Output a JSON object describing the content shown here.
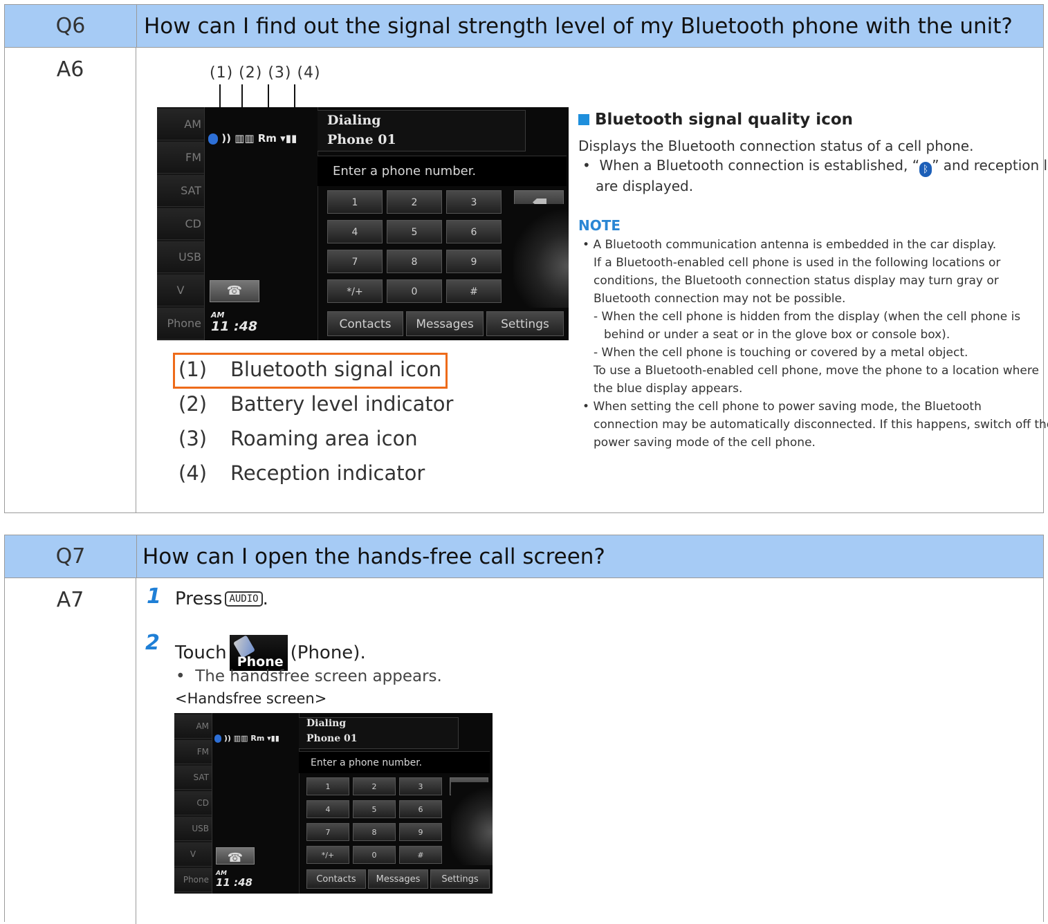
{
  "q6": {
    "number": "Q6",
    "question": "How can I find out the signal strength level of my Bluetooth phone with the unit?",
    "answer_number": "A6",
    "callout_numbers": "(1) (2)  (3)  (4)",
    "legend": [
      {
        "n": "(1)",
        "label": "Bluetooth signal icon",
        "highlighted": true
      },
      {
        "n": "(2)",
        "label": "Battery level indicator"
      },
      {
        "n": "(3)",
        "label": "Roaming area icon"
      },
      {
        "n": "(4)",
        "label": "Reception indicator"
      }
    ],
    "right": {
      "heading": "Bluetooth signal quality icon",
      "desc": "Displays the Bluetooth connection status of a cell phone.",
      "bullet1_a": "When a Bluetooth connection is established, “",
      "bullet1_b": "” and reception level",
      "bullet1_c": "are displayed.",
      "note_title": "NOTE",
      "note_lines": [
        "A Bluetooth communication antenna is embedded in the car display.",
        "If a Bluetooth-enabled cell phone is used in the following locations or",
        "conditions, the Bluetooth connection status display may turn gray or",
        "Bluetooth connection may not be possible.",
        "When the cell phone is hidden from the display (when the cell phone is",
        "behind or under a seat or in the glove box or console box).",
        "When the cell phone is touching or covered by a metal object.",
        "To use a Bluetooth-enabled cell phone, move the phone to a location where",
        "the blue display appears.",
        "When setting the cell phone to power saving mode, the Bluetooth",
        "connection may be automatically disconnected. If this happens, switch off the",
        "power saving mode of the cell phone."
      ]
    }
  },
  "screen": {
    "sources": [
      "AM",
      "FM",
      "SAT",
      "CD",
      "USB",
      "V",
      "Phone"
    ],
    "status": "Rm",
    "title1": "Dialing",
    "title2": "Phone 01",
    "entry": "Enter a phone number.",
    "keys": [
      "1",
      "2",
      "3",
      "4",
      "5",
      "6",
      "7",
      "8",
      "9",
      "*/+",
      "0",
      "#"
    ],
    "fkeys": [
      "Contacts",
      "Messages",
      "Settings"
    ],
    "clock_ampm": "AM",
    "clock": "11 :48"
  },
  "q7": {
    "number": "Q7",
    "question": "How can I open the hands-free call screen?",
    "answer_number": "A7",
    "step1_num": "1",
    "step1_text": "Press",
    "step1_key": "AUDIO",
    "step1_end": ".",
    "step2_num": "2",
    "step2_text": "Touch",
    "step2_icon_label": "Phone",
    "step2_end": "(Phone).",
    "result": "The handsfree screen appears.",
    "caption": "<Handsfree screen>"
  }
}
